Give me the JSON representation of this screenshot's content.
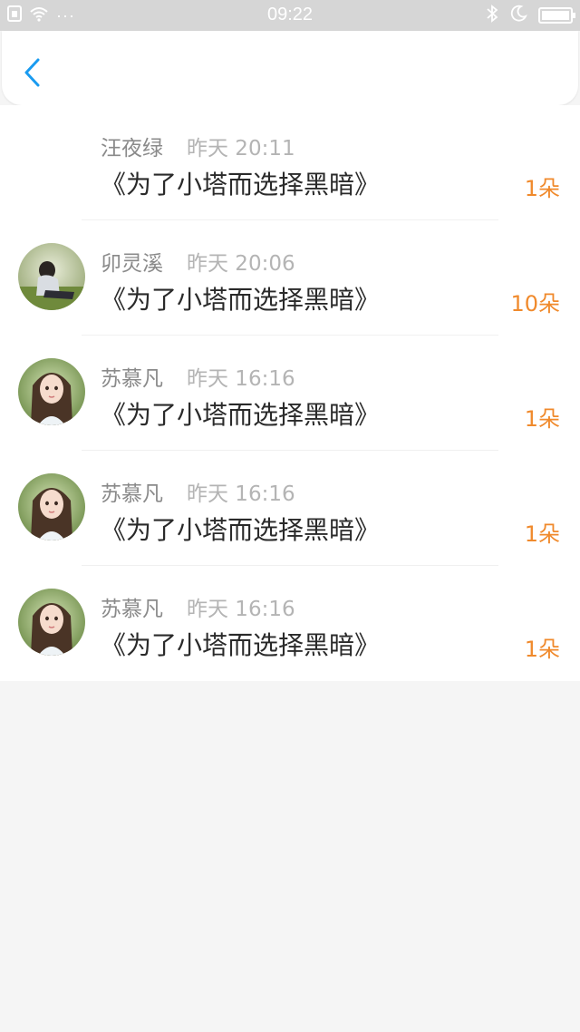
{
  "status_bar": {
    "time": "09:22",
    "dots": "···",
    "battery_level": 1.0
  },
  "colors": {
    "accent_blue": "#1a9bf0",
    "flower_orange": "#f08a2c",
    "name_gray": "#8a8a8a",
    "time_gray": "#b4b4b4"
  },
  "nav": {
    "back_icon": "chevron-left-icon"
  },
  "gifts": [
    {
      "name": "汪夜绿",
      "time": "昨天 20:11",
      "title": "《为了小塔而选择黑暗》",
      "count": "1朵",
      "avatar": "none"
    },
    {
      "name": "卯灵溪",
      "time": "昨天 20:06",
      "title": "《为了小塔而选择黑暗》",
      "count": "10朵",
      "avatar": "photo-sitting"
    },
    {
      "name": "苏慕凡",
      "time": "昨天 16:16",
      "title": "《为了小塔而选择黑暗》",
      "count": "1朵",
      "avatar": "photo-girl"
    },
    {
      "name": "苏慕凡",
      "time": "昨天 16:16",
      "title": "《为了小塔而选择黑暗》",
      "count": "1朵",
      "avatar": "photo-girl"
    },
    {
      "name": "苏慕凡",
      "time": "昨天 16:16",
      "title": "《为了小塔而选择黑暗》",
      "count": "1朵",
      "avatar": "photo-girl"
    }
  ]
}
